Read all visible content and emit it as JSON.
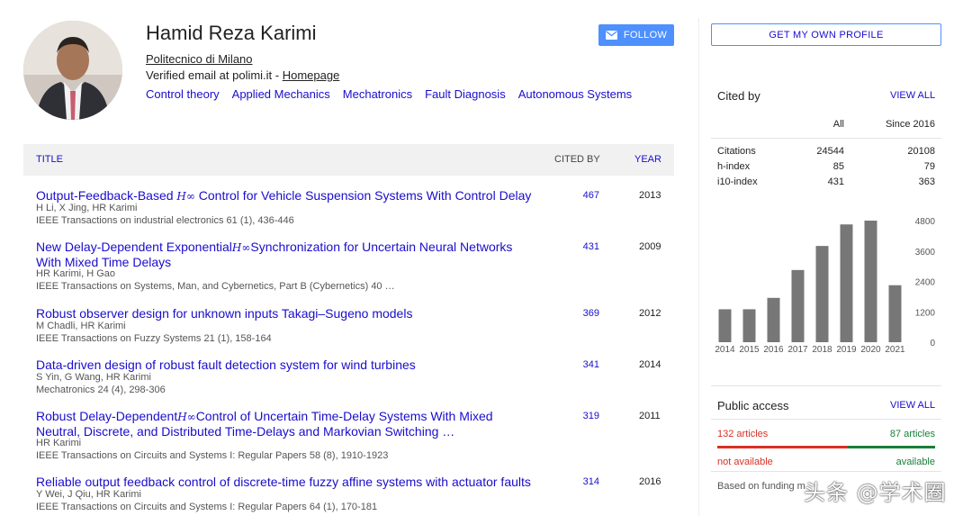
{
  "profile": {
    "name": "Hamid Reza Karimi",
    "affiliation": "Politecnico di Milano",
    "email": "Verified email at polimi.it - ",
    "homepage": "Homepage",
    "interests": [
      "Control theory",
      "Applied Mechanics",
      "Mechatronics",
      "Fault Diagnosis",
      "Autonomous Systems"
    ],
    "follow_label": "FOLLOW"
  },
  "table": {
    "header": {
      "title": "TITLE",
      "cited_by": "CITED BY",
      "year": "YEAR"
    },
    "rows": [
      {
        "title_pre": "Output-Feedback-Based ",
        "title_sym": "H∞",
        "title_post": " Control for Vehicle Suspension Systems With Control Delay",
        "authors": "H Li, X Jing, HR Karimi",
        "journal": "IEEE Transactions on industrial electronics 61 (1), 436-446",
        "cited": "467",
        "year": "2013"
      },
      {
        "title_pre": "New Delay-Dependent Exponential",
        "title_sym": "H∞",
        "title_post": "Synchronization for Uncertain Neural Networks With Mixed Time Delays",
        "authors": "HR Karimi, H Gao",
        "journal": "IEEE Transactions on Systems, Man, and Cybernetics, Part B (Cybernetics) 40 …",
        "cited": "431",
        "year": "2009"
      },
      {
        "title_pre": "Robust observer design for unknown inputs Takagi–Sugeno models",
        "title_sym": "",
        "title_post": "",
        "authors": "M Chadli, HR Karimi",
        "journal": "IEEE Transactions on Fuzzy Systems 21 (1), 158-164",
        "cited": "369",
        "year": "2012"
      },
      {
        "title_pre": "Data-driven design of robust fault detection system for wind turbines",
        "title_sym": "",
        "title_post": "",
        "authors": "S Yin, G Wang, HR Karimi",
        "journal": "Mechatronics 24 (4), 298-306",
        "cited": "341",
        "year": "2014"
      },
      {
        "title_pre": "Robust Delay-Dependent",
        "title_sym": "H∞",
        "title_post": "Control of Uncertain Time-Delay Systems With Mixed Neutral, Discrete, and Distributed Time-Delays and Markovian Switching …",
        "authors": "HR Karimi",
        "journal": "IEEE Transactions on Circuits and Systems I: Regular Papers 58 (8), 1910-1923",
        "cited": "319",
        "year": "2011"
      },
      {
        "title_pre": "Reliable output feedback control of discrete-time fuzzy affine systems with actuator faults",
        "title_sym": "",
        "title_post": "",
        "authors": "Y Wei, J Qiu, HR Karimi",
        "journal": "IEEE Transactions on Circuits and Systems I: Regular Papers 64 (1), 170-181",
        "cited": "314",
        "year": "2016"
      }
    ]
  },
  "sidebar": {
    "own_profile_label": "GET MY OWN PROFILE",
    "cited_by_heading": "Cited by",
    "view_all": "VIEW ALL",
    "col_all": "All",
    "col_since": "Since 2016",
    "stats": [
      {
        "label": "Citations",
        "all": "24544",
        "since": "20108"
      },
      {
        "label": "h-index",
        "all": "85",
        "since": "79"
      },
      {
        "label": "i10-index",
        "all": "431",
        "since": "363"
      }
    ],
    "public_access_heading": "Public access",
    "public_view_all": "VIEW ALL",
    "articles_red": "132 articles",
    "articles_green": "87 articles",
    "not_available": "not available",
    "available": "available",
    "funding_text": "Based on funding m",
    "unavailable_fraction": 0.6
  },
  "chart_data": {
    "type": "bar",
    "categories": [
      "2014",
      "2015",
      "2016",
      "2017",
      "2018",
      "2019",
      "2020",
      "2021"
    ],
    "values": [
      1300,
      1300,
      1750,
      2850,
      3800,
      4650,
      4800,
      2250
    ],
    "ylim": [
      0,
      4800
    ],
    "yticks": [
      0,
      1200,
      2400,
      3600,
      4800
    ],
    "bar_color": "#777777"
  },
  "watermark": "头条 @学术圈",
  "colors": {
    "link": "#1a0dcc",
    "button": "#4d90fe",
    "red": "#d93025",
    "green": "#188038"
  }
}
